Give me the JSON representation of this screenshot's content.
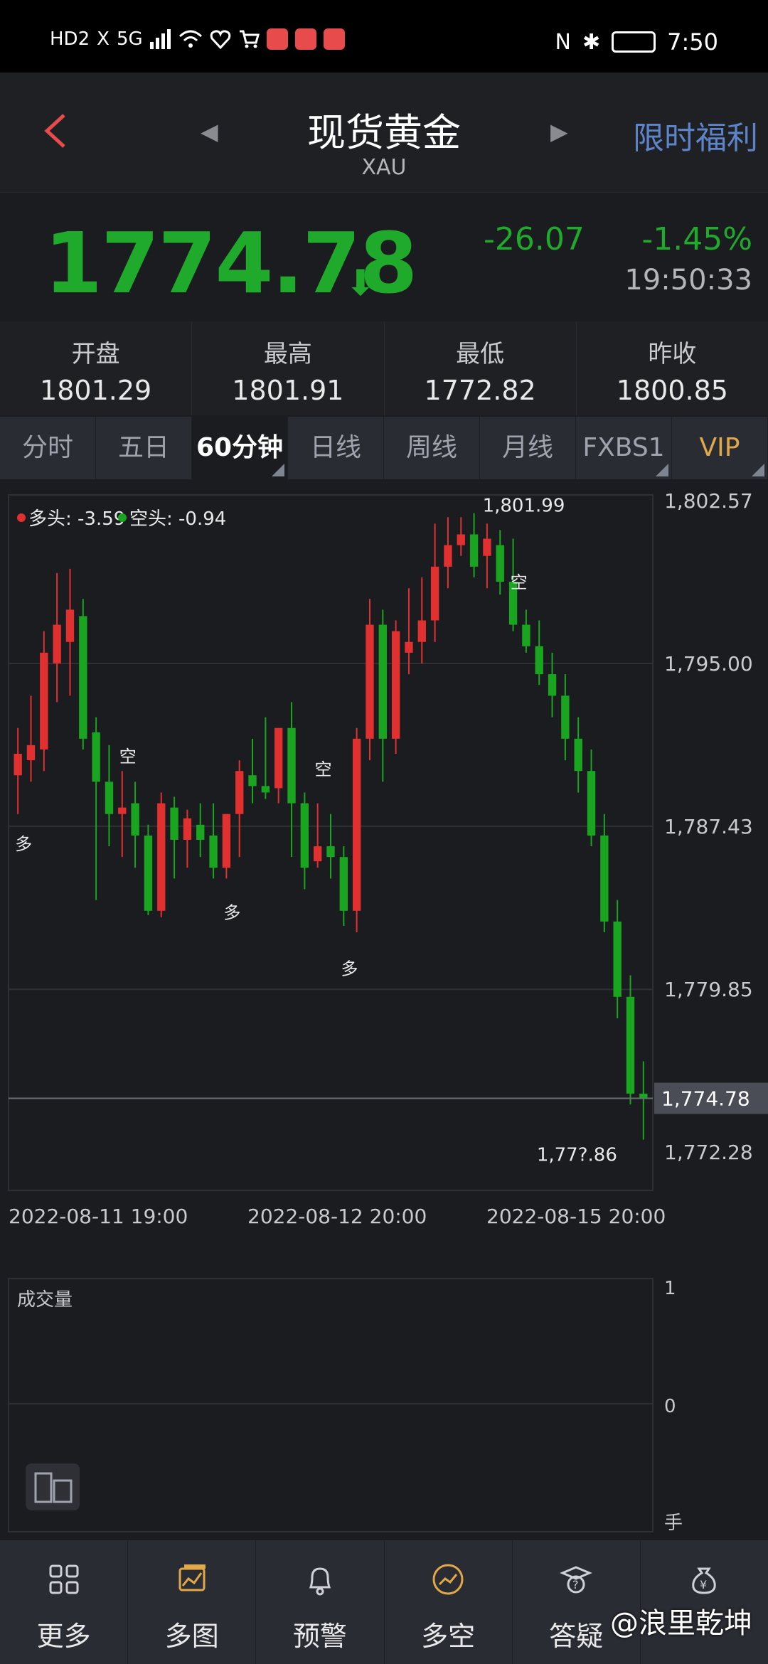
{
  "status_bar": {
    "left_icons": [
      "HD2",
      "X",
      "5G",
      "signal-bars-icon",
      "wifi-icon",
      "heart-icon",
      "cart-icon"
    ],
    "right_icons": [
      "nfc-icon",
      "bluetooth-icon",
      "battery-icon"
    ],
    "time": "7:50"
  },
  "header": {
    "title": "现货黄金",
    "subtitle": "XAU",
    "promo": "限时福利"
  },
  "quote": {
    "price": "1774.78",
    "change": "-26.07",
    "change_pct": "-1.45%",
    "time": "19:50:33",
    "color_down": "#1faa2b"
  },
  "stats": [
    {
      "label": "开盘",
      "value": "1801.29"
    },
    {
      "label": "最高",
      "value": "1801.91"
    },
    {
      "label": "最低",
      "value": "1772.82"
    },
    {
      "label": "昨收",
      "value": "1800.85"
    }
  ],
  "tabs": [
    {
      "label": "分时",
      "active": false
    },
    {
      "label": "五日",
      "active": false
    },
    {
      "label": "60分钟",
      "active": true
    },
    {
      "label": "日线",
      "active": false
    },
    {
      "label": "周线",
      "active": false
    },
    {
      "label": "月线",
      "active": false
    },
    {
      "label": "FXBS1",
      "active": false
    },
    {
      "label": "VIP",
      "active": false
    }
  ],
  "chart": {
    "legend_long": "多头: -3.59",
    "legend_short": "空头: -0.94",
    "color_up": "#e03030",
    "color_down": "#19a51f",
    "y_ticks": [
      "1,802.57",
      "1,795.00",
      "1,787.43",
      "1,779.85",
      "1,772.28"
    ],
    "current_price_label": "1,774.78",
    "high_annotation": "1,801.99",
    "low_annotation": "1,77?.86",
    "x_ticks": [
      "2022-08-11 19:00",
      "2022-08-12 20:00",
      "2022-08-15 20:00"
    ],
    "signal_labels": [
      "多",
      "空",
      "多",
      "空",
      "多",
      "空"
    ]
  },
  "chart_data": {
    "type": "candlestick",
    "title": "",
    "xlabel": "",
    "ylabel": "",
    "ylim": [
      1770.5,
      1802.57
    ],
    "current_price": 1774.78,
    "candles": [
      {
        "o": 1789.8,
        "h": 1792.0,
        "l": 1788.0,
        "c": 1790.8
      },
      {
        "o": 1790.5,
        "h": 1793.5,
        "l": 1789.5,
        "c": 1791.2
      },
      {
        "o": 1791.0,
        "h": 1796.5,
        "l": 1790.0,
        "c": 1795.5
      },
      {
        "o": 1795.0,
        "h": 1799.2,
        "l": 1793.2,
        "c": 1796.8
      },
      {
        "o": 1796.0,
        "h": 1799.4,
        "l": 1793.5,
        "c": 1797.5
      },
      {
        "o": 1797.2,
        "h": 1798.0,
        "l": 1791.0,
        "c": 1791.5
      },
      {
        "o": 1791.8,
        "h": 1792.5,
        "l": 1784.0,
        "c": 1789.5
      },
      {
        "o": 1789.5,
        "h": 1791.2,
        "l": 1786.5,
        "c": 1788.0
      },
      {
        "o": 1788.0,
        "h": 1790.0,
        "l": 1786.0,
        "c": 1788.3
      },
      {
        "o": 1788.5,
        "h": 1789.5,
        "l": 1785.5,
        "c": 1787.0
      },
      {
        "o": 1787.0,
        "h": 1787.5,
        "l": 1783.3,
        "c": 1783.5
      },
      {
        "o": 1783.5,
        "h": 1789.0,
        "l": 1783.2,
        "c": 1788.5
      },
      {
        "o": 1788.3,
        "h": 1788.8,
        "l": 1785.0,
        "c": 1786.8
      },
      {
        "o": 1786.8,
        "h": 1788.2,
        "l": 1785.5,
        "c": 1787.8
      },
      {
        "o": 1787.5,
        "h": 1788.5,
        "l": 1786.0,
        "c": 1786.8
      },
      {
        "o": 1787.0,
        "h": 1788.5,
        "l": 1785.0,
        "c": 1785.5
      },
      {
        "o": 1785.5,
        "h": 1788.0,
        "l": 1785.0,
        "c": 1788.0
      },
      {
        "o": 1788.0,
        "h": 1790.5,
        "l": 1786.0,
        "c": 1790.0
      },
      {
        "o": 1789.8,
        "h": 1791.5,
        "l": 1788.5,
        "c": 1789.3
      },
      {
        "o": 1789.3,
        "h": 1792.5,
        "l": 1788.7,
        "c": 1789.0
      },
      {
        "o": 1789.2,
        "h": 1792.0,
        "l": 1788.5,
        "c": 1792.0
      },
      {
        "o": 1792.0,
        "h": 1793.2,
        "l": 1786.0,
        "c": 1788.5
      },
      {
        "o": 1788.5,
        "h": 1789.0,
        "l": 1784.5,
        "c": 1785.5
      },
      {
        "o": 1785.8,
        "h": 1788.5,
        "l": 1785.5,
        "c": 1786.5
      },
      {
        "o": 1786.5,
        "h": 1788.0,
        "l": 1785.0,
        "c": 1786.0
      },
      {
        "o": 1786.0,
        "h": 1786.5,
        "l": 1782.8,
        "c": 1783.5
      },
      {
        "o": 1783.5,
        "h": 1792.0,
        "l": 1782.5,
        "c": 1791.5
      },
      {
        "o": 1791.5,
        "h": 1798.0,
        "l": 1790.5,
        "c": 1796.8
      },
      {
        "o": 1796.8,
        "h": 1797.5,
        "l": 1789.5,
        "c": 1791.5
      },
      {
        "o": 1791.5,
        "h": 1797.0,
        "l": 1790.8,
        "c": 1796.5
      },
      {
        "o": 1795.5,
        "h": 1798.5,
        "l": 1794.5,
        "c": 1796.0
      },
      {
        "o": 1796.0,
        "h": 1799.0,
        "l": 1795.0,
        "c": 1797.0
      },
      {
        "o": 1797.0,
        "h": 1801.5,
        "l": 1796.0,
        "c": 1799.5
      },
      {
        "o": 1799.5,
        "h": 1801.8,
        "l": 1798.5,
        "c": 1800.5
      },
      {
        "o": 1800.5,
        "h": 1801.8,
        "l": 1800.0,
        "c": 1801.0
      },
      {
        "o": 1801.0,
        "h": 1801.99,
        "l": 1799.0,
        "c": 1799.5
      },
      {
        "o": 1800.0,
        "h": 1801.5,
        "l": 1798.5,
        "c": 1800.8
      },
      {
        "o": 1800.5,
        "h": 1801.2,
        "l": 1798.2,
        "c": 1798.8
      },
      {
        "o": 1798.8,
        "h": 1800.8,
        "l": 1796.5,
        "c": 1796.8
      },
      {
        "o": 1796.8,
        "h": 1797.5,
        "l": 1795.5,
        "c": 1795.8
      },
      {
        "o": 1795.8,
        "h": 1797.0,
        "l": 1794.0,
        "c": 1794.5
      },
      {
        "o": 1794.5,
        "h": 1795.5,
        "l": 1792.5,
        "c": 1793.5
      },
      {
        "o": 1793.5,
        "h": 1794.5,
        "l": 1790.5,
        "c": 1791.5
      },
      {
        "o": 1791.5,
        "h": 1792.5,
        "l": 1789.0,
        "c": 1790.0
      },
      {
        "o": 1790.0,
        "h": 1791.0,
        "l": 1786.5,
        "c": 1787.0
      },
      {
        "o": 1787.0,
        "h": 1788.0,
        "l": 1782.5,
        "c": 1783.0
      },
      {
        "o": 1783.0,
        "h": 1784.0,
        "l": 1778.5,
        "c": 1779.5
      },
      {
        "o": 1779.5,
        "h": 1780.5,
        "l": 1774.5,
        "c": 1775.0
      },
      {
        "o": 1775.0,
        "h": 1776.5,
        "l": 1772.86,
        "c": 1774.78
      }
    ],
    "volume_axis_ticks": [
      "1",
      "0",
      "手"
    ]
  },
  "volume": {
    "label": "成交量"
  },
  "bottom_nav": [
    {
      "label": "更多",
      "icon": "grid-icon"
    },
    {
      "label": "多图",
      "icon": "multi-chart-icon"
    },
    {
      "label": "预警",
      "icon": "bell-icon"
    },
    {
      "label": "多空",
      "icon": "trend-icon"
    },
    {
      "label": "答疑",
      "icon": "question-icon"
    },
    {
      "label": "",
      "icon": "money-bag-icon"
    }
  ],
  "watermark": "@浪里乾坤"
}
